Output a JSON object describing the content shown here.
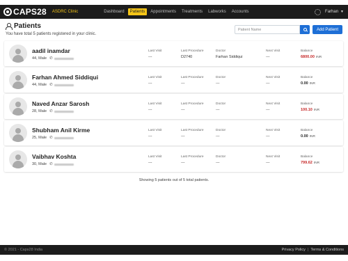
{
  "app": {
    "brand": "CAPS28",
    "clinic": "ASDRC Clinic",
    "user": "Farhan",
    "nav": [
      "Dashboard",
      "Patients",
      "Appointments",
      "Treatments",
      "Labworks",
      "Accounts"
    ],
    "active_nav": "Patients",
    "accent_color": "#f5c518",
    "primary_color": "#1e6fd6"
  },
  "header": {
    "title": "Patients",
    "subtitle": "You have total 5 patients registered in your clinic.",
    "search_placeholder": "Patient Name",
    "search_value": "",
    "add_button": "Add Patient"
  },
  "columns": {
    "last_visit": "Last Visit",
    "last_procedure": "Last Procedure",
    "doctor": "Doctor",
    "next_visit": "Next Visit",
    "balance": "Balance"
  },
  "patients": [
    {
      "name": "aadil inamdar",
      "meta": "44, Male",
      "last_visit": "---",
      "last_procedure": "D2740",
      "doctor": "Farhan Siddiqui",
      "next_visit": "---",
      "balance": "6800.00",
      "currency": "INR",
      "balance_status": "due"
    },
    {
      "name": "Farhan Ahmed Siddiqui",
      "meta": "44, Male",
      "last_visit": "---",
      "last_procedure": "---",
      "doctor": "---",
      "next_visit": "---",
      "balance": "0.00",
      "currency": "INR",
      "balance_status": "clear"
    },
    {
      "name": "Naved Anzar Sarosh",
      "meta": "28, Male",
      "last_visit": "---",
      "last_procedure": "---",
      "doctor": "---",
      "next_visit": "---",
      "balance": "100.10",
      "currency": "INR",
      "balance_status": "due"
    },
    {
      "name": "Shubham Anil Kirme",
      "meta": "25, Male",
      "last_visit": "---",
      "last_procedure": "---",
      "doctor": "---",
      "next_visit": "---",
      "balance": "0.00",
      "currency": "INR",
      "balance_status": "clear"
    },
    {
      "name": "Vaibhav Koshta",
      "meta": "30, Male",
      "last_visit": "---",
      "last_procedure": "---",
      "doctor": "---",
      "next_visit": "---",
      "balance": "799.62",
      "currency": "INR",
      "balance_status": "due"
    }
  ],
  "summary": "Showing 5 patients out of 5 total patients.",
  "footer": {
    "copyright": "© 2021 - Caps28 India",
    "links": [
      "Privacy Policy",
      "Terms & Conditions"
    ],
    "separator": "|"
  }
}
